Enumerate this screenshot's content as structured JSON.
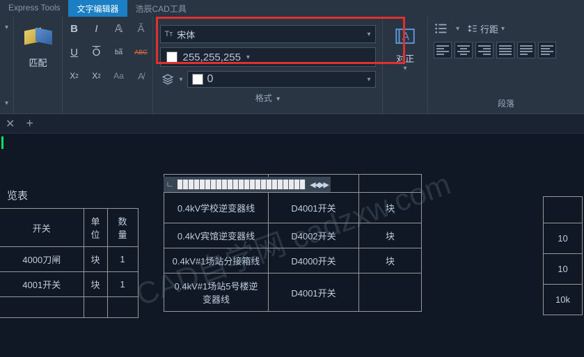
{
  "tabs": {
    "express": "Express Tools",
    "editor": "文字编辑器",
    "cad": "浩辰CAD工具"
  },
  "ribbon": {
    "match": "匹配",
    "font": "宋体",
    "color": "255,255,255",
    "byLayer": "0",
    "formatGroup": "格式",
    "justify": "对正",
    "lineSpacing": "行距",
    "paragraphGroup": "段落"
  },
  "leftTable": {
    "title": "览表",
    "hdr": {
      "switch": "开关",
      "unit": "单位",
      "qty": "数量"
    },
    "rows": [
      {
        "switch": "4000刀闸",
        "unit": "块",
        "qty": "1"
      },
      {
        "switch": "4001开关",
        "unit": "块",
        "qty": "1"
      }
    ]
  },
  "midTable": {
    "rows": [
      {
        "desc": "0.4kV学校逆变器线",
        "sw": "D4001开关",
        "unit": "块"
      },
      {
        "desc": "0.4kV宾馆逆变器线",
        "sw": "D4002开关",
        "unit": "块"
      },
      {
        "desc": "0.4kV#1场站分接箱线",
        "sw": "D4000开关",
        "unit": "块"
      },
      {
        "desc": "0.4kV#1场站5号楼逆变器线",
        "sw": "D4001开关",
        "unit": ""
      }
    ]
  },
  "rightTable": {
    "rows": [
      "10",
      "10",
      "10k"
    ]
  },
  "watermark": "CAD自学网 cadzxw.com"
}
